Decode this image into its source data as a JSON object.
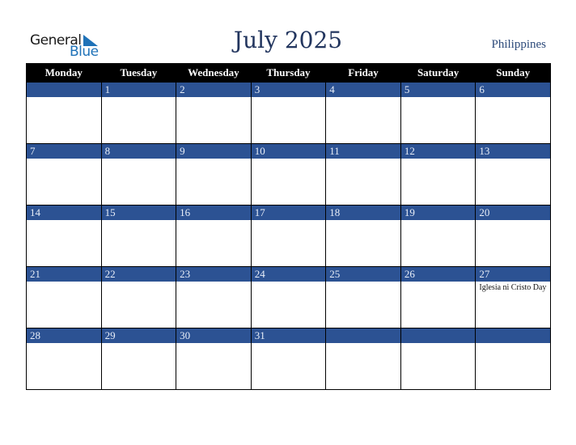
{
  "logo": {
    "word1": "General",
    "word2": "Blue"
  },
  "title": "July 2025",
  "country": "Philippines",
  "colors": {
    "header_bg": "#000000",
    "day_bar": "#2c5293",
    "title": "#22355e",
    "logo_blue": "#1f72b8"
  },
  "weekdays": [
    "Monday",
    "Tuesday",
    "Wednesday",
    "Thursday",
    "Friday",
    "Saturday",
    "Sunday"
  ],
  "weeks": [
    [
      {
        "d": ""
      },
      {
        "d": "1"
      },
      {
        "d": "2"
      },
      {
        "d": "3"
      },
      {
        "d": "4"
      },
      {
        "d": "5"
      },
      {
        "d": "6"
      }
    ],
    [
      {
        "d": "7"
      },
      {
        "d": "8"
      },
      {
        "d": "9"
      },
      {
        "d": "10"
      },
      {
        "d": "11"
      },
      {
        "d": "12"
      },
      {
        "d": "13"
      }
    ],
    [
      {
        "d": "14"
      },
      {
        "d": "15"
      },
      {
        "d": "16"
      },
      {
        "d": "17"
      },
      {
        "d": "18"
      },
      {
        "d": "19"
      },
      {
        "d": "20"
      }
    ],
    [
      {
        "d": "21"
      },
      {
        "d": "22"
      },
      {
        "d": "23"
      },
      {
        "d": "24"
      },
      {
        "d": "25"
      },
      {
        "d": "26"
      },
      {
        "d": "27",
        "holiday": "Iglesia ni Cristo Day"
      }
    ],
    [
      {
        "d": "28"
      },
      {
        "d": "29"
      },
      {
        "d": "30"
      },
      {
        "d": "31"
      },
      {
        "d": ""
      },
      {
        "d": ""
      },
      {
        "d": ""
      }
    ]
  ]
}
